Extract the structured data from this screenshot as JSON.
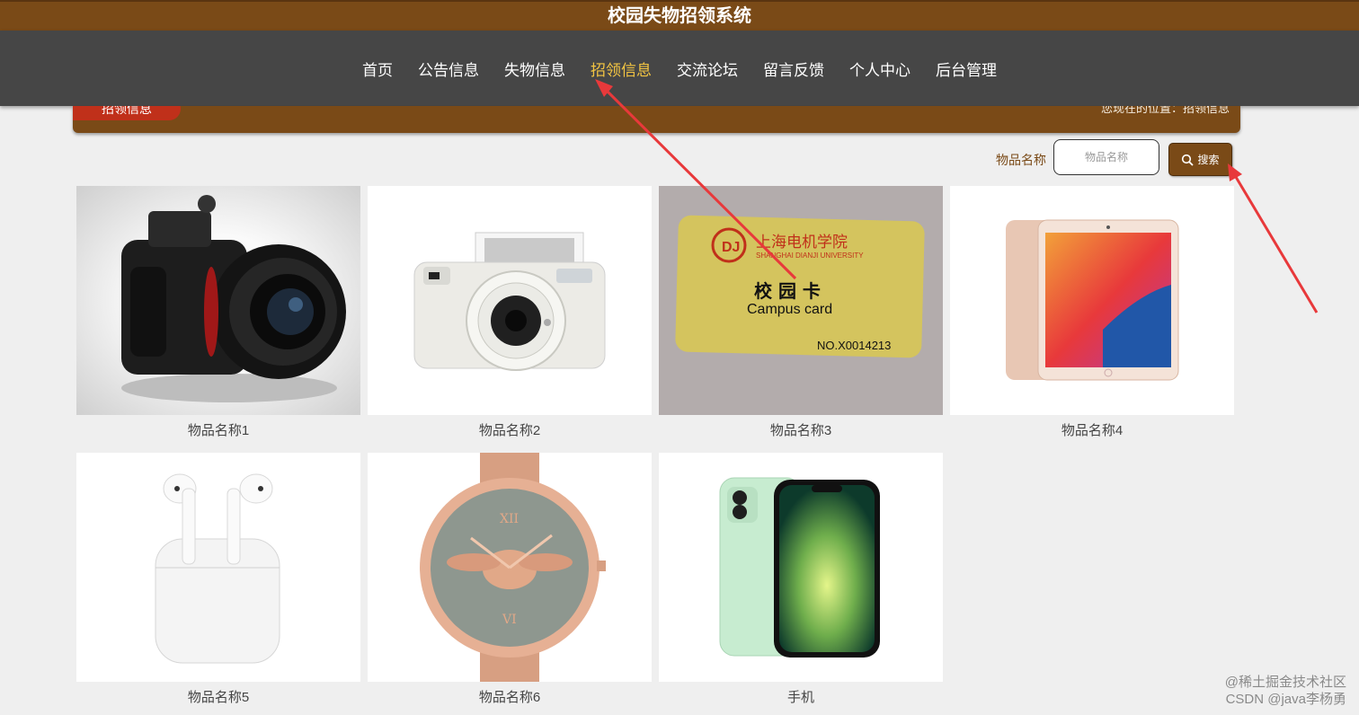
{
  "site_title": "校园失物招领系统",
  "nav": [
    {
      "label": "首页"
    },
    {
      "label": "公告信息"
    },
    {
      "label": "失物信息"
    },
    {
      "label": "招领信息",
      "active": true
    },
    {
      "label": "交流论坛"
    },
    {
      "label": "留言反馈"
    },
    {
      "label": "个人中心"
    },
    {
      "label": "后台管理"
    }
  ],
  "breadcrumb": {
    "tag": "招领信息",
    "location": "您现在的位置：招领信息"
  },
  "search": {
    "label": "物品名称",
    "placeholder": "物品名称",
    "button": "搜索"
  },
  "items": [
    {
      "name": "物品名称1"
    },
    {
      "name": "物品名称2"
    },
    {
      "name": "物品名称3",
      "card_text": {
        "school": "上海电机学院",
        "school_en": "SHANGHAI DIANJI UNIVERSITY",
        "title": "校 园 卡",
        "subtitle": "Campus card",
        "number": "NO.X0014213"
      }
    },
    {
      "name": "物品名称4"
    },
    {
      "name": "物品名称5"
    },
    {
      "name": "物品名称6"
    },
    {
      "name": "手机"
    }
  ],
  "watermark": {
    "line1": "@稀土掘金技术社区",
    "line2": "CSDN @java李杨勇"
  },
  "colors": {
    "brand": "#7a4a17",
    "nav_bg": "#464646",
    "active": "#f4c542",
    "annotation": "#e8393b"
  }
}
